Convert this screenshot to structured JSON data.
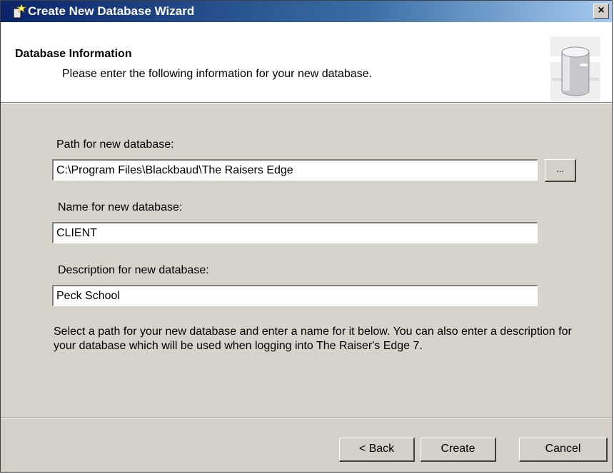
{
  "window": {
    "title": "Create New Database Wizard",
    "close_label": "×"
  },
  "header": {
    "title": "Database Information",
    "subtitle": "Please enter the following information for your new database."
  },
  "form": {
    "path_label": "Path for new database:",
    "path_value": "C:\\Program Files\\Blackbaud\\The Raisers Edge",
    "browse_label": "...",
    "name_label": "Name for new database:",
    "name_value": "CLIENT",
    "description_label": "Description for new database:",
    "description_value": "Peck School"
  },
  "instructions": "Select a path for your new database and enter a name for it below. You can also enter a description for your database which will be used when logging into The Raiser's Edge 7.",
  "footer": {
    "back_label": "< Back",
    "create_label": "Create",
    "cancel_label": "Cancel"
  },
  "icons": {
    "title_icon": "wizard-wand-icon",
    "header_icon": "database-cylinder-icon"
  }
}
